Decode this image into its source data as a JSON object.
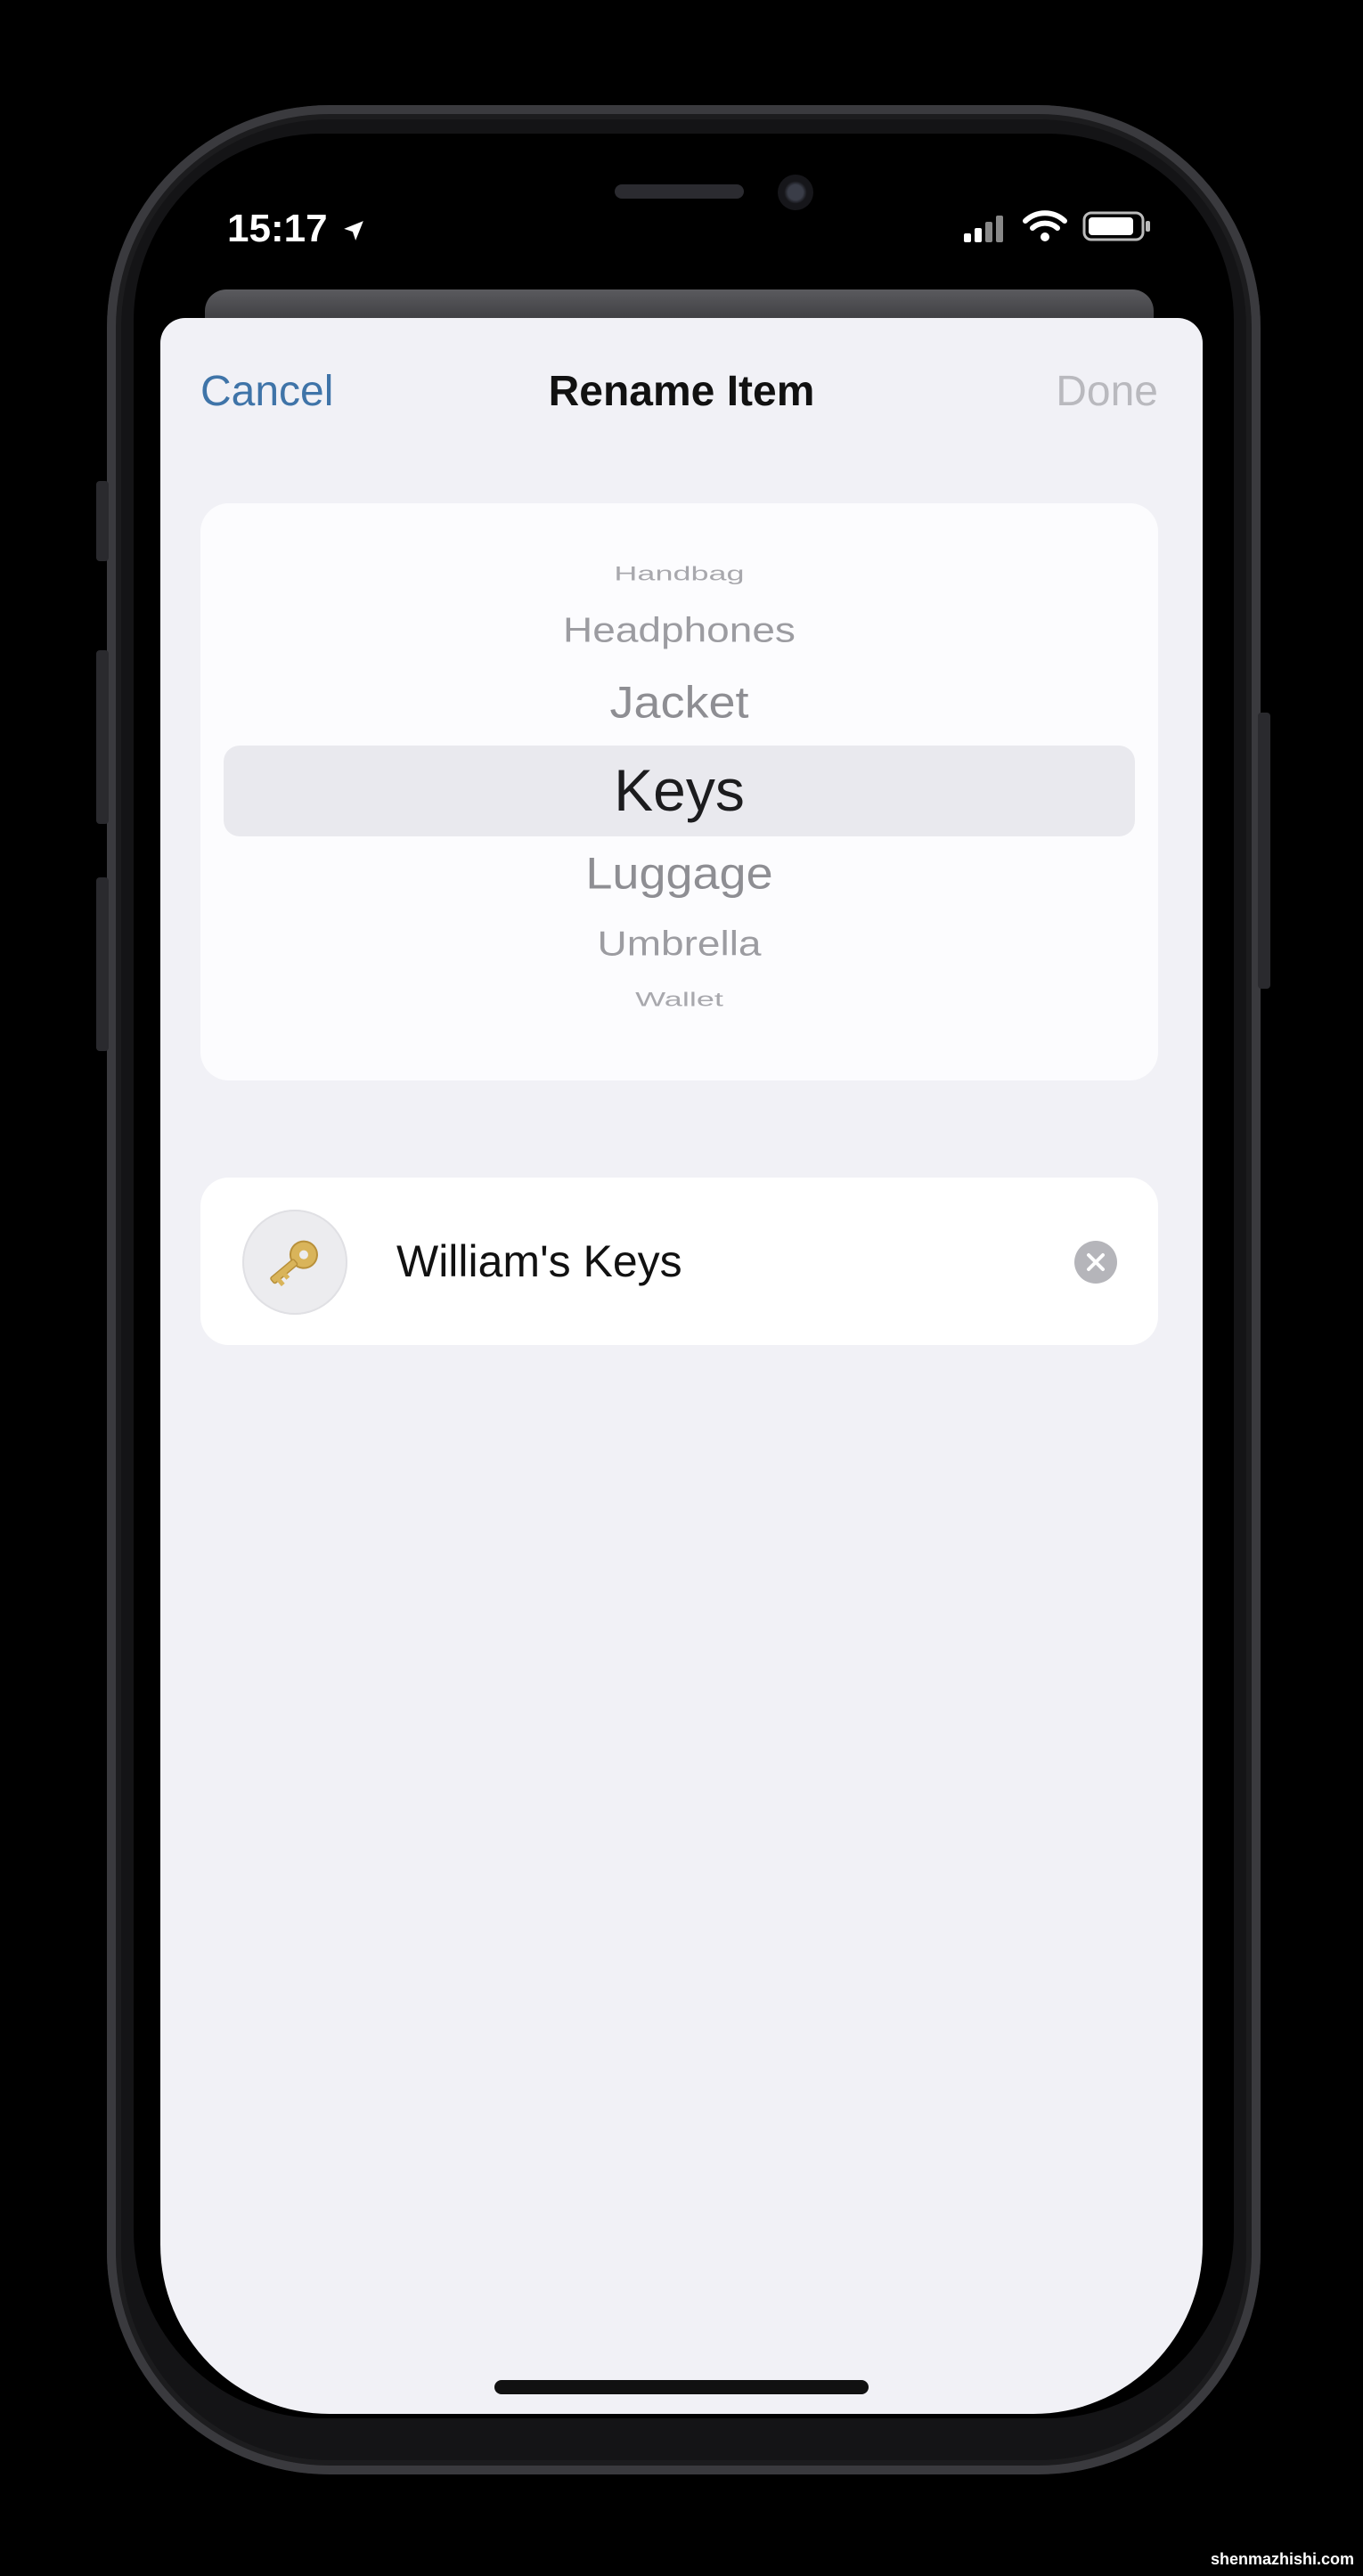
{
  "status_bar": {
    "time": "15:17"
  },
  "nav": {
    "cancel": "Cancel",
    "title": "Rename Item",
    "done": "Done"
  },
  "picker": {
    "items": [
      "Handbag",
      "Headphones",
      "Jacket",
      "Keys",
      "Luggage",
      "Umbrella",
      "Wallet"
    ],
    "selected": "Keys"
  },
  "name_field": {
    "value": "William's Keys",
    "icon": "key-icon"
  },
  "colors": {
    "accent": "#3f74a8",
    "disabled": "#b9b9be",
    "sheet_background": "#f1f1f6",
    "key": "#d9b45a"
  },
  "watermark": "shenmazhishi.com"
}
